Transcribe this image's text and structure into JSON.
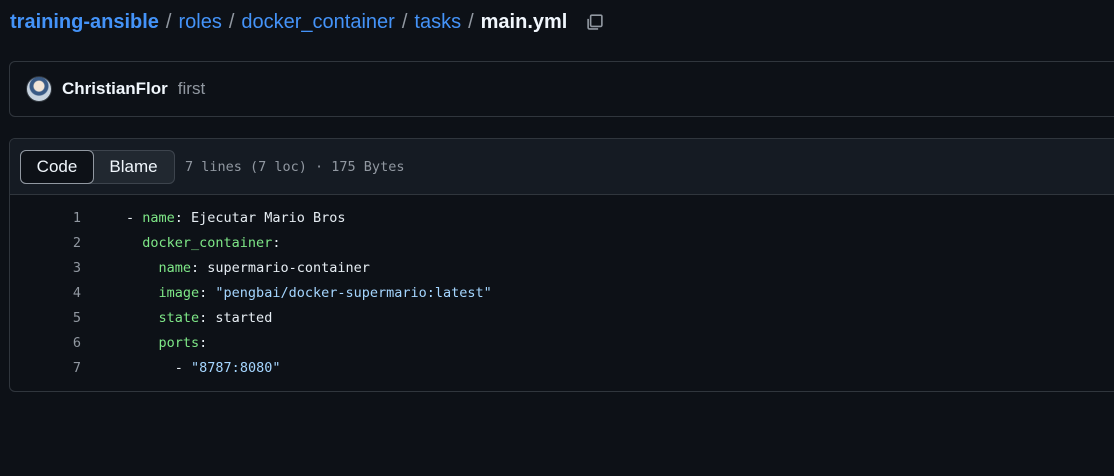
{
  "breadcrumb": {
    "repo": "training-ansible",
    "parts": [
      "roles",
      "docker_container",
      "tasks"
    ],
    "separator": "/",
    "file": "main.yml"
  },
  "commit": {
    "author": "ChristianFlor",
    "message": "first"
  },
  "file": {
    "tabs": [
      "Code",
      "Blame"
    ],
    "active_tab": "Code",
    "meta": "7 lines (7 loc) · 175 Bytes",
    "lines": [
      {
        "num": "1",
        "indent": "",
        "dash": "- ",
        "key": "name",
        "colon": ": ",
        "value": "Ejecutar Mario Bros"
      },
      {
        "num": "2",
        "indent": "  ",
        "dash": "",
        "key": "docker_container",
        "colon": ":",
        "value": ""
      },
      {
        "num": "3",
        "indent": "    ",
        "dash": "",
        "key": "name",
        "colon": ": ",
        "value": "supermario-container"
      },
      {
        "num": "4",
        "indent": "    ",
        "dash": "",
        "key": "image",
        "colon": ": ",
        "value": "\"pengbai/docker-supermario:latest\""
      },
      {
        "num": "5",
        "indent": "    ",
        "dash": "",
        "key": "state",
        "colon": ": ",
        "value": "started"
      },
      {
        "num": "6",
        "indent": "    ",
        "dash": "",
        "key": "ports",
        "colon": ":",
        "value": ""
      },
      {
        "num": "7",
        "indent": "      ",
        "dash": "- ",
        "key": "",
        "colon": "",
        "value": "\"8787:8080\""
      }
    ]
  },
  "colors": {
    "background": "#0d1117",
    "link": "#4493f8",
    "yaml_key": "#7ee787",
    "yaml_string": "#a5d6ff",
    "muted": "#9198a1"
  },
  "icons": {
    "copy": "copy-icon"
  }
}
